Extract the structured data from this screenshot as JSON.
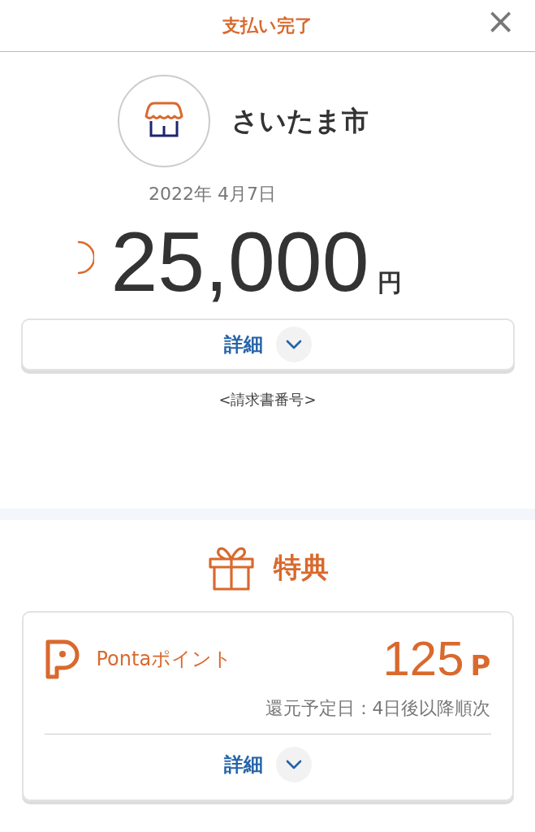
{
  "header": {
    "title": "支払い完了",
    "close": "×"
  },
  "payment": {
    "merchant": "さいたま市",
    "date": "2022年 4月7日",
    "amount": "25,000",
    "currency": "円",
    "details_button": "詳細",
    "invoice_label": "<請求書番号>"
  },
  "benefits": {
    "title": "特典",
    "items": [
      {
        "name": "Pontaポイント",
        "points": "125",
        "unit": "P",
        "schedule": "還元予定日：4日後以降順次",
        "details_button": "詳細"
      }
    ]
  }
}
